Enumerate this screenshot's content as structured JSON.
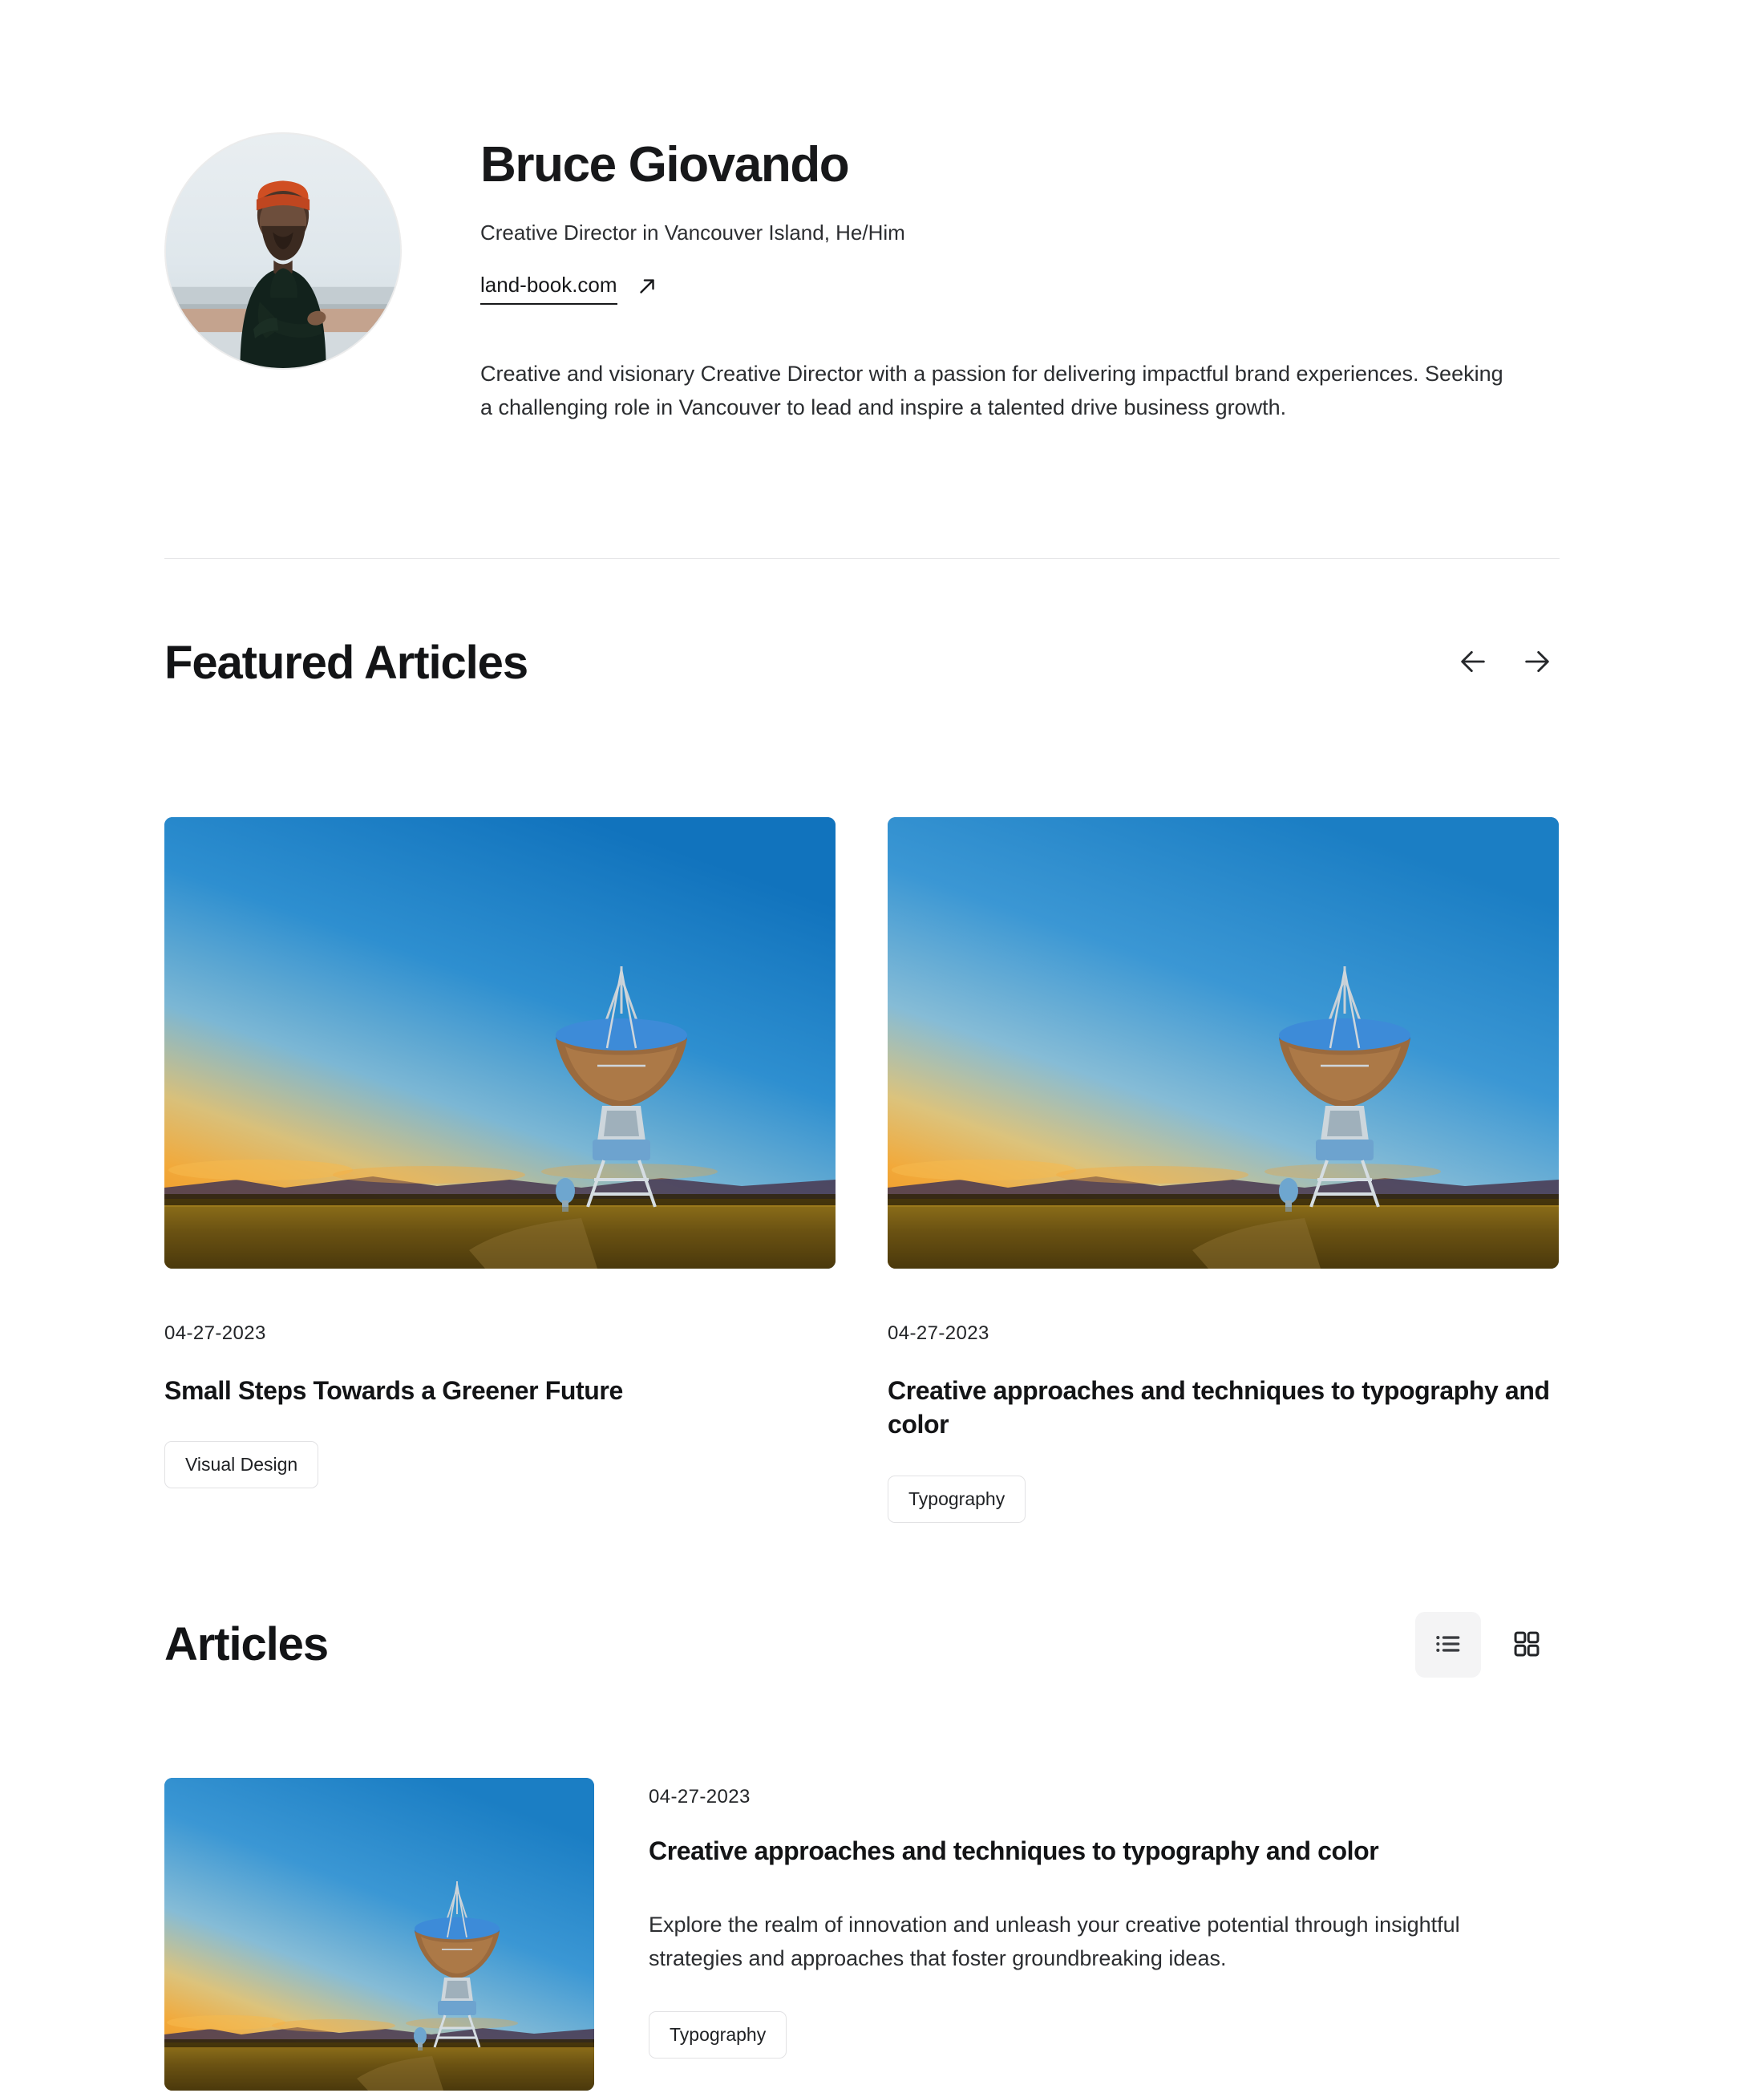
{
  "profile": {
    "name": "Bruce Giovando",
    "role": "Creative Director in Vancouver Island, He/Him",
    "website": "land-book.com",
    "external_link_icon": "arrow-up-right-icon",
    "bio": "Creative and visionary Creative Director with a passion for delivering impactful brand experiences. Seeking a challenging role in Vancouver to lead and inspire a talented drive business growth.",
    "avatar_alt": "portrait of a man in an orange beanie and black turtleneck"
  },
  "featured": {
    "title": "Featured Articles",
    "prev_icon": "arrow-left-icon",
    "next_icon": "arrow-right-icon",
    "cards": [
      {
        "date": "04-27-2023",
        "title": "Small Steps Towards a Greener Future",
        "tag": "Visual Design",
        "image_alt": "radio telescope dish at sunset over a golden field"
      },
      {
        "date": "04-27-2023",
        "title": "Creative approaches and techniques to typography and color",
        "tag": "Typography",
        "image_alt": "radio telescope dish at sunset over a golden field"
      }
    ]
  },
  "articles": {
    "title": "Articles",
    "view_list_icon": "list-view-icon",
    "view_grid_icon": "grid-view-icon",
    "active_view": "list",
    "items": [
      {
        "date": "04-27-2023",
        "title": "Creative approaches and techniques to typography and color",
        "description": "Explore the realm of innovation and unleash your creative potential through insightful strategies and approaches that foster groundbreaking ideas.",
        "tag": "Typography",
        "image_alt": "radio telescope dish at sunset over a golden field"
      }
    ]
  },
  "colors": {
    "text": "#131416",
    "muted": "#2b2d30",
    "divider": "#e6e6e8",
    "border": "#e2e2e4",
    "active_bg": "#f4f4f5"
  }
}
